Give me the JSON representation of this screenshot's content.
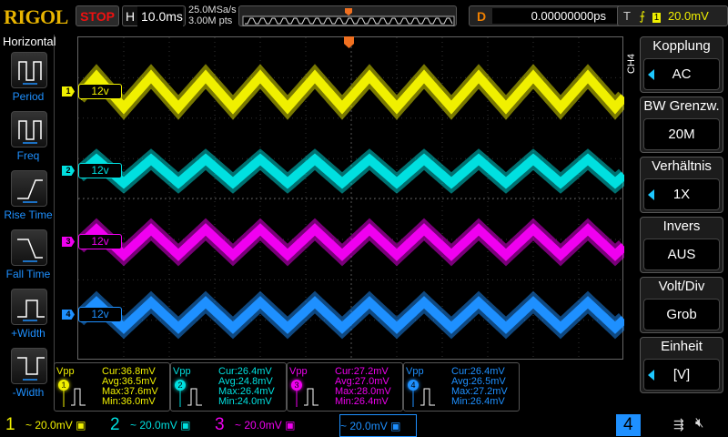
{
  "header": {
    "logo": "RIGOL",
    "run_state": "STOP",
    "h_label": "H",
    "timebase": "10.0ms",
    "sample_rate": "25.0MSa/s",
    "memory_depth": "3.00M pts",
    "delay_label": "D",
    "delay": "0.00000000ps",
    "trigger_label": "T",
    "trigger_source": "1",
    "trigger_level": "20.0mV"
  },
  "left_menu": {
    "title": "Horizontal",
    "items": [
      {
        "label": "Period",
        "icon": "period-icon"
      },
      {
        "label": "Freq",
        "icon": "freq-icon"
      },
      {
        "label": "Rise Time",
        "icon": "rise-time-icon"
      },
      {
        "label": "Fall Time",
        "icon": "fall-time-icon"
      },
      {
        "label": "+Width",
        "icon": "pos-width-icon"
      },
      {
        "label": "-Width",
        "icon": "neg-width-icon"
      }
    ]
  },
  "channels": [
    {
      "num": "1",
      "label": "12v",
      "color": "#f0f000",
      "scale": "20.0mV",
      "coupling": "~"
    },
    {
      "num": "2",
      "label": "12v",
      "color": "#00e0e0",
      "scale": "20.0mV",
      "coupling": "~"
    },
    {
      "num": "3",
      "label": "12v",
      "color": "#f000f0",
      "scale": "20.0mV",
      "coupling": "~"
    },
    {
      "num": "4",
      "label": "12v",
      "color": "#1e90ff",
      "scale": "20.0mV",
      "coupling": "~"
    }
  ],
  "measurements": [
    {
      "type": "Vpp",
      "ch": "1",
      "cur": "Cur:36.8mV",
      "avg": "Avg:36.5mV",
      "max": "Max:37.6mV",
      "min": "Min:36.0mV"
    },
    {
      "type": "Vpp",
      "ch": "2",
      "cur": "Cur:26.4mV",
      "avg": "Avg:24.8mV",
      "max": "Max:26.4mV",
      "min": "Min:24.0mV"
    },
    {
      "type": "Vpp",
      "ch": "3",
      "cur": "Cur:27.2mV",
      "avg": "Avg:27.0mV",
      "max": "Max:28.0mV",
      "min": "Min:26.4mV"
    },
    {
      "type": "Vpp",
      "ch": "4",
      "cur": "Cur:26.4mV",
      "avg": "Avg:26.5mV",
      "max": "Max:27.2mV",
      "min": "Min:26.4mV"
    }
  ],
  "right_menu": {
    "channel": "CH4",
    "items": [
      {
        "title": "Kopplung",
        "value": "AC",
        "arrow": true
      },
      {
        "title": "BW Grenzw.",
        "value": "20M",
        "arrow": false
      },
      {
        "title": "Verhältnis",
        "value": "1X",
        "arrow": true
      },
      {
        "title": "Invers",
        "value": "AUS",
        "arrow": false
      },
      {
        "title": "Volt/Div",
        "value": "Grob",
        "arrow": false
      },
      {
        "title": "Einheit",
        "value": "[V]",
        "arrow": true
      }
    ]
  },
  "waveform": {
    "periods_on_screen": 10
  }
}
